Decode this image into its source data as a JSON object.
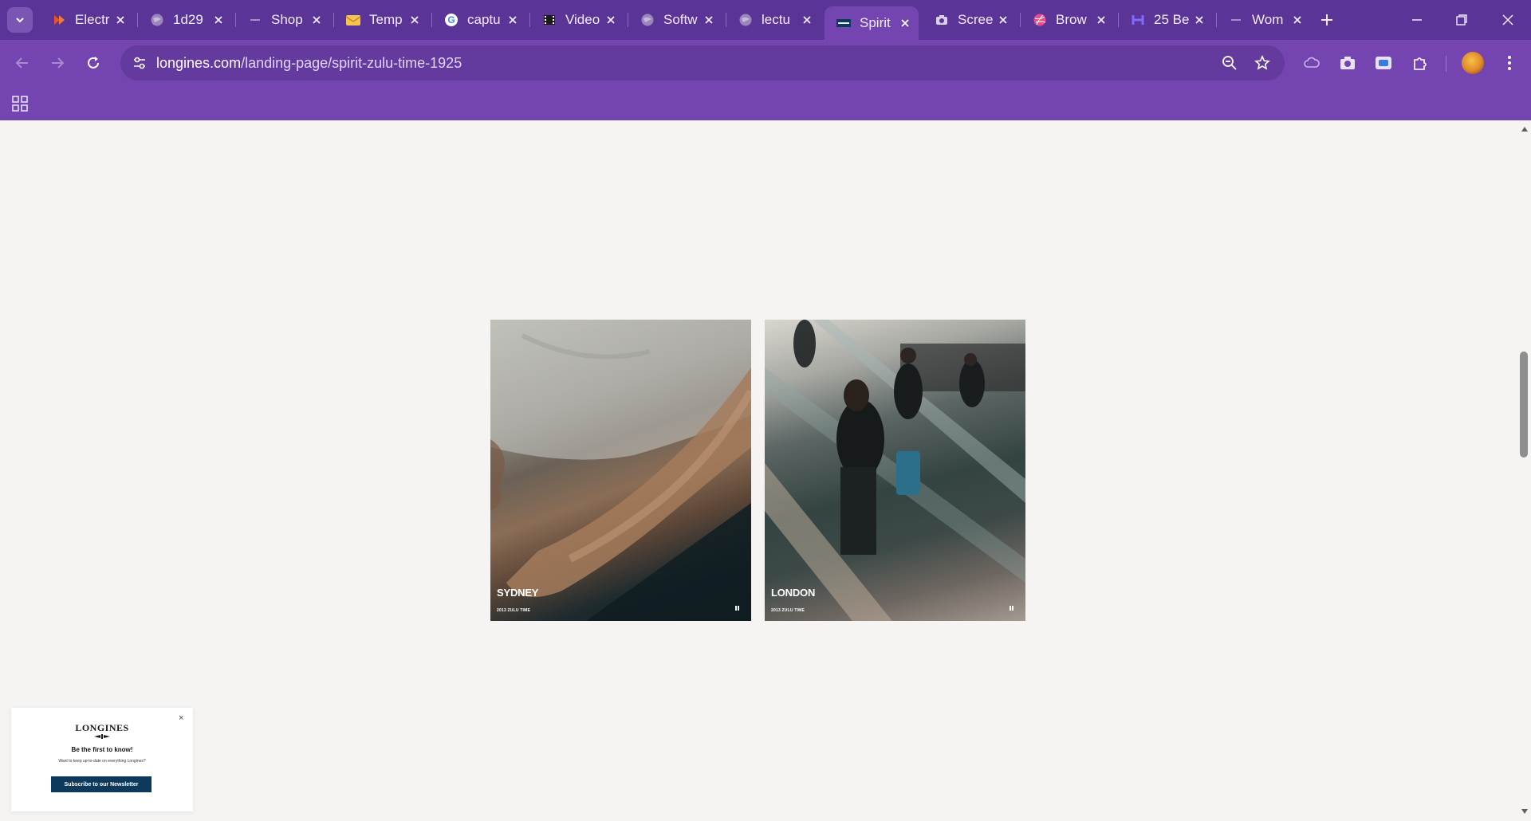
{
  "browser": {
    "tabs": [
      {
        "title": "Electr",
        "icon": "red-brand-icon"
      },
      {
        "title": "1d29",
        "icon": "globe-icon"
      },
      {
        "title": "Shop",
        "icon": "dash-icon"
      },
      {
        "title": "Temp",
        "icon": "envelope-icon"
      },
      {
        "title": "captu",
        "icon": "google-icon"
      },
      {
        "title": "Video",
        "icon": "film-icon"
      },
      {
        "title": "Softw",
        "icon": "globe-icon"
      },
      {
        "title": "lectu",
        "icon": "globe-icon"
      },
      {
        "title": "Spirit",
        "icon": "longines-icon",
        "active": true
      },
      {
        "title": "Scree",
        "icon": "camera-icon"
      },
      {
        "title": "Brow",
        "icon": "dribbble-icon"
      },
      {
        "title": "25 Be",
        "icon": "h-brand-icon"
      },
      {
        "title": "Wom",
        "icon": "dash-icon"
      }
    ],
    "url_domain": "longines.com",
    "url_path": "/landing-page/spirit-zulu-time-1925",
    "colors": {
      "tabstrip": "#5a3597",
      "toolbar": "#7445b0",
      "omnibox": "#643a9f"
    }
  },
  "page": {
    "cards": [
      {
        "city": "SYDNEY",
        "subtitle": "2013 ZULU TIME"
      },
      {
        "city": "LONDON",
        "subtitle": "2013 ZULU TIME"
      }
    ],
    "popup": {
      "close": "×",
      "logo": "LONGINES",
      "title": "Be the first to know!",
      "text": "Want to keep up-to-date on everything Longines?",
      "button": "Subscribe to our Newsletter"
    }
  }
}
